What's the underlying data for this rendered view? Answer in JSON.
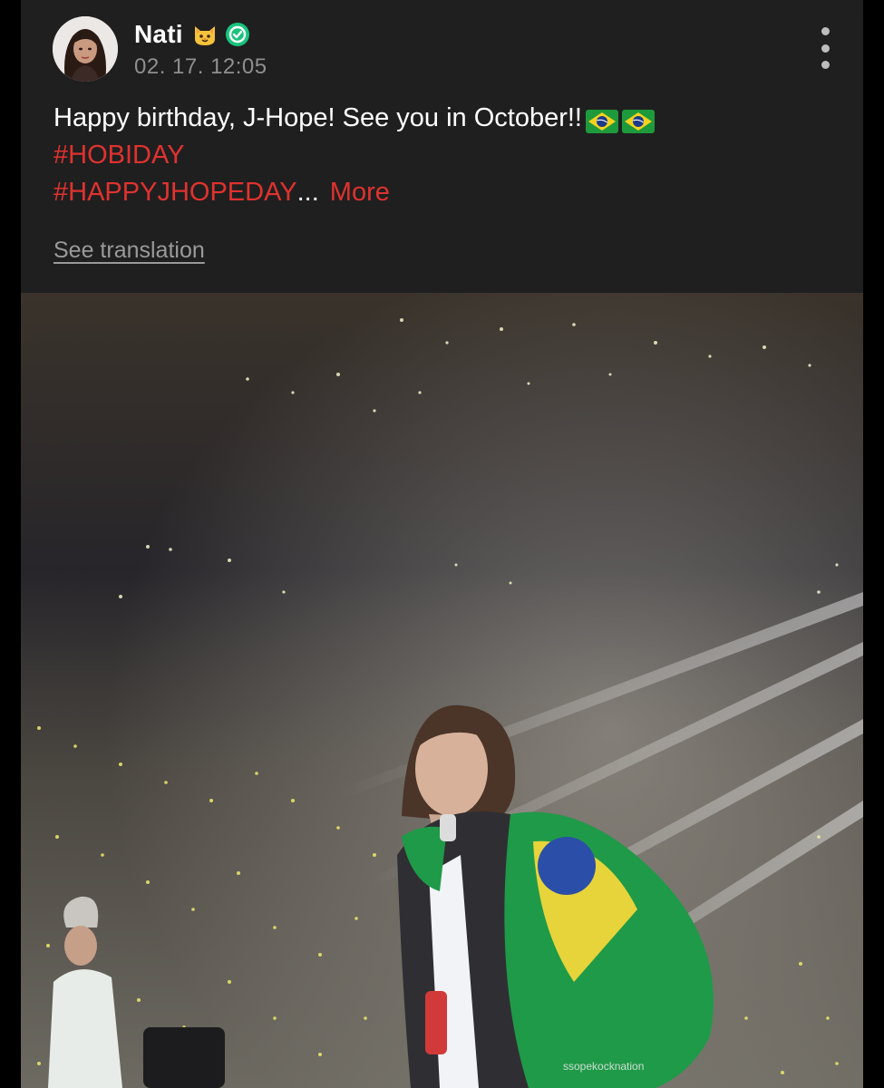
{
  "post": {
    "author": {
      "name": "Nati",
      "name_emoji": "cat-face-emoji",
      "badge_icon": "verified-icon",
      "date": "02. 17. 12:05"
    },
    "text": {
      "line1": "Happy birthday, J-Hope! See you in October!!",
      "flags": [
        "brazil-flag-emoji",
        "brazil-flag-emoji"
      ],
      "hashtag1": "#HOBIDAY",
      "hashtag2": "#HAPPYJHOPEDAY",
      "ellipsis": "...",
      "more_label": "More"
    },
    "see_translation_label": "See translation",
    "image": {
      "watermark": "ssopekocknation"
    }
  },
  "colors": {
    "background": "#000000",
    "card": "#1f1f1f",
    "hashtag": "#e0322f",
    "verified_badge": "#19c37d",
    "muted_text": "#8f8f8f"
  }
}
